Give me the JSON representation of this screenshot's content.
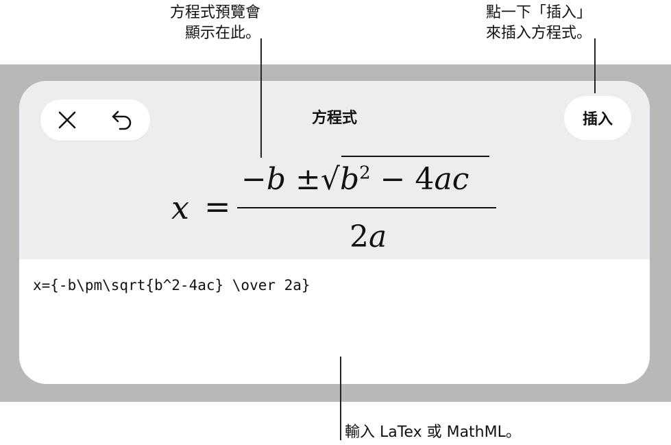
{
  "callouts": {
    "preview_line1": "方程式預覽會",
    "preview_line2": "顯示在此。",
    "insert_line1": "點一下「插入」",
    "insert_line2": "來插入方程式。",
    "input": "輸入 LaTex 或 MathML。"
  },
  "toolbar": {
    "title": "方程式",
    "insert_label": "插入",
    "close_icon": "close-icon",
    "undo_icon": "undo-icon"
  },
  "preview": {
    "lhs": "x",
    "equals": "=",
    "numerator_minus": "−",
    "numerator_b": "b",
    "plus_minus": "±",
    "radical": "√",
    "radicand_b": "b",
    "exponent": "2",
    "radicand_rest": " − 4",
    "radicand_ac": "ac",
    "denominator_num": "2",
    "denominator_var": "a"
  },
  "editor": {
    "value": "x={-b\\pm\\sqrt{b^2-4ac} \\over 2a}"
  },
  "colors": {
    "backdrop": "#b6b9b6",
    "preview_bg": "#ededf0",
    "sheet_bg": "#ffffff"
  }
}
